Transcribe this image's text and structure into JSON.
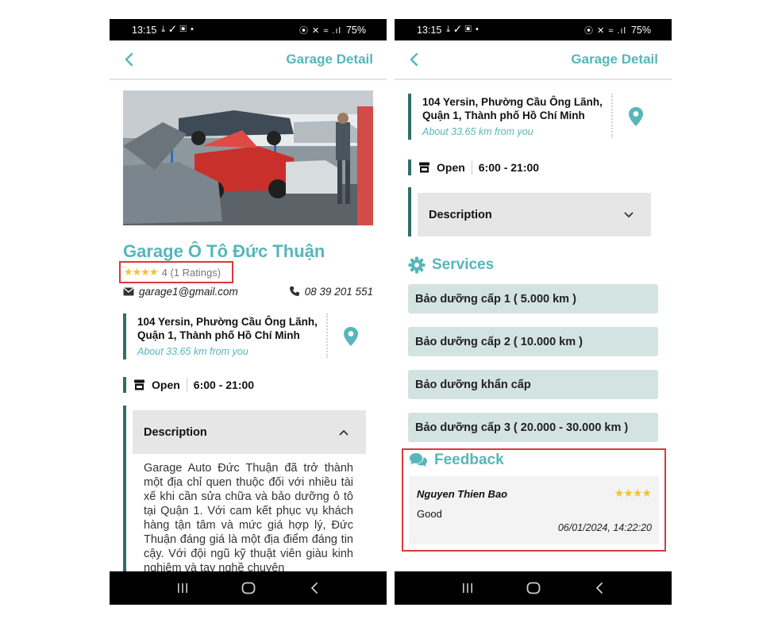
{
  "status_bar": {
    "time": "13:15",
    "icons_left": "⤓ ✓ ▣ •",
    "icons_right": "⦿ ✕ ≈ .ıl",
    "battery": "75%"
  },
  "app_bar": {
    "title": "Garage Detail"
  },
  "garage": {
    "name": "Garage Ô Tô Đức Thuận",
    "rating_stars": "★★★★",
    "rating_text": "4 (1 Ratings)",
    "email": "garage1@gmail.com",
    "phone": "08 39 201 551",
    "address": "104 Yersin, Phường Cầu Ông Lãnh, Quận 1, Thành phố Hồ Chí Minh",
    "distance": "About 33.65 km from you",
    "open_status": "Open",
    "hours": "6:00 - 21:00"
  },
  "description": {
    "header": "Description",
    "text": "Garage Auto Đức Thuận đã trở thành một địa chỉ quen thuộc đối với nhiều tài xế khi cần sửa chữa và bảo dưỡng ô tô tại Quận 1. Với cam kết phục vụ khách hàng tận tâm và mức giá hợp lý, Đức Thuận đáng giá là một địa điểm đáng tin cậy. Với đội ngũ kỹ thuật viên giàu kinh nghiệm và tay nghề chuyên"
  },
  "services": {
    "title": "Services",
    "items": [
      "Bảo dưỡng cấp 1 ( 5.000 km )",
      "Bảo dưỡng cấp 2 ( 10.000 km )",
      "Bảo dưỡng khẩn cấp",
      "Bảo dưỡng cấp 3 ( 20.000 - 30.000 km )"
    ]
  },
  "feedback": {
    "title": "Feedback",
    "items": [
      {
        "name": "Nguyen Thien Bao",
        "stars": "★★★★",
        "comment": "Good",
        "date": "06/01/2024, 14:22:20"
      }
    ]
  },
  "colors": {
    "accent": "#56b6b9",
    "dark_accent": "#2f6e69",
    "service_bg": "#d3e3e1",
    "highlight_border": "#d9393a",
    "star": "#f2c230"
  },
  "icons": [
    "back-chevron-icon",
    "envelope-icon",
    "phone-icon",
    "map-pin-icon",
    "store-icon",
    "chevron-icon",
    "gear-icon",
    "chat-bubbles-icon",
    "recents-icon",
    "home-icon",
    "back-icon"
  ]
}
